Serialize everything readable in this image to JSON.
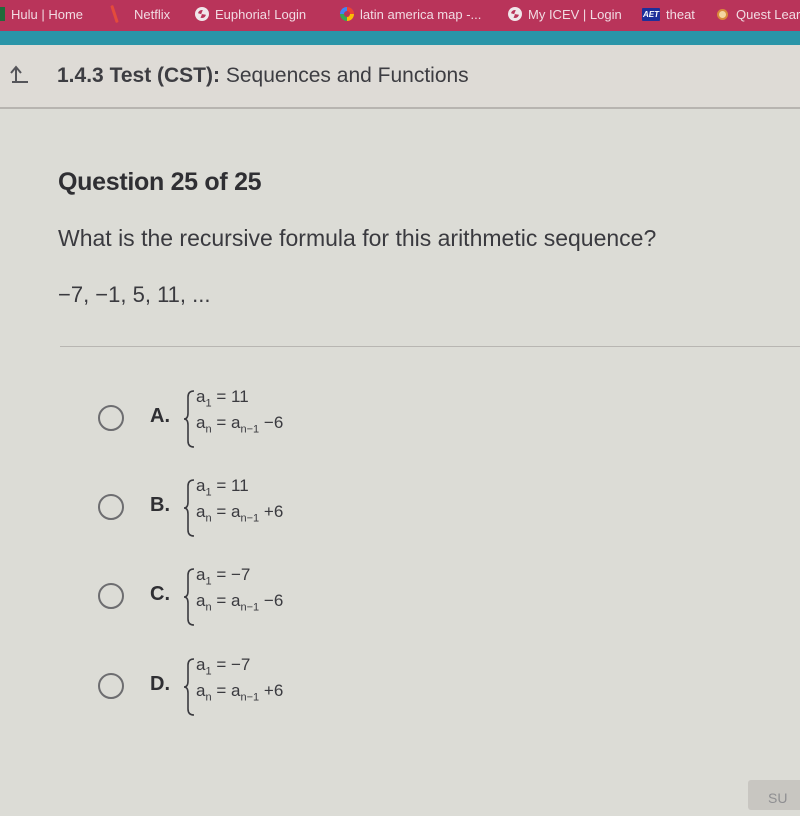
{
  "browser": {
    "bookmarks": [
      {
        "label": "Hulu | Home",
        "icon": "hulu-icon"
      },
      {
        "label": "Netflix",
        "icon": "netflix-icon"
      },
      {
        "label": "Euphoria! Login",
        "icon": "globe-icon"
      },
      {
        "label": "latin america map -...",
        "icon": "google-icon"
      },
      {
        "label": "My ICEV | Login",
        "icon": "globe-icon"
      },
      {
        "label": "theat",
        "icon": "aet-icon"
      },
      {
        "label": "Quest Lear",
        "icon": "quest-icon"
      }
    ],
    "aet_badge": "AET"
  },
  "header": {
    "test_number": "1.4.3",
    "test_label": "Test (CST):",
    "test_name": "Sequences and Functions"
  },
  "question": {
    "title": "Question 25 of 25",
    "prompt": "What is the recursive formula for this arithmetic sequence?",
    "sequence": "−7, −1, 5, 11, ..."
  },
  "options": [
    {
      "letter": "A.",
      "a1": "11",
      "op": "−",
      "d": "6",
      "selected": false
    },
    {
      "letter": "B.",
      "a1": "11",
      "op": "+",
      "d": "6",
      "selected": false
    },
    {
      "letter": "C.",
      "a1": "−7",
      "op": "−",
      "d": "6",
      "selected": false
    },
    {
      "letter": "D.",
      "a1": "−7",
      "op": "+",
      "d": "6",
      "selected": false
    }
  ],
  "formula_parts": {
    "a": "a",
    "sub_1": "1",
    "sub_n": "n",
    "sub_n_minus_1": "n−1",
    "equals": "="
  },
  "footer": {
    "submit_label": "SU"
  }
}
